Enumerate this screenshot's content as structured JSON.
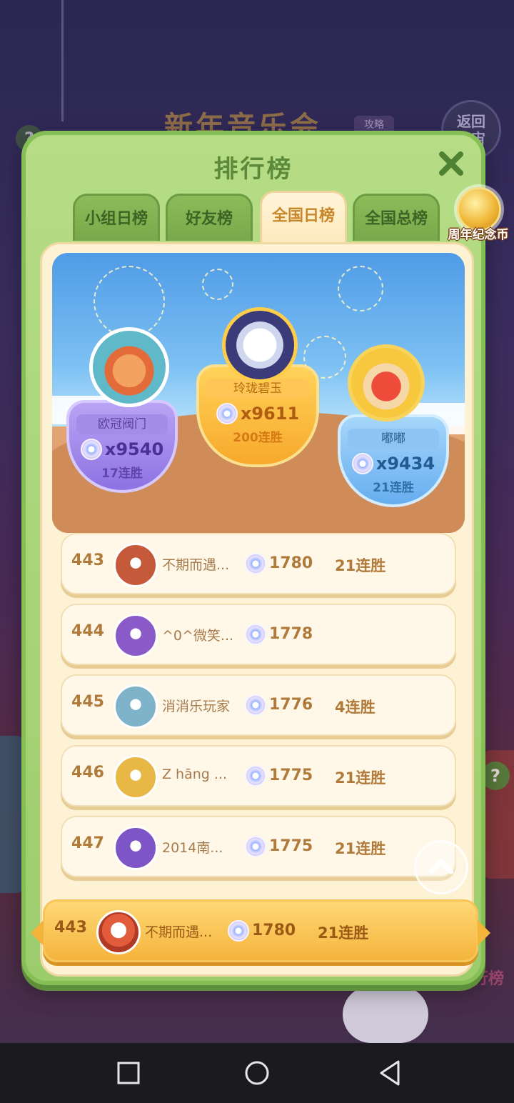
{
  "background": {
    "event_title": "新年音乐会",
    "strategy_label": "攻略",
    "return_label": "返回\n宇宙",
    "help_glyph": "?",
    "leaderboard_label": "排行榜"
  },
  "modal": {
    "title": "排行榜",
    "close_icon": "close-icon",
    "tabs": [
      {
        "label": "小组日榜",
        "active": false
      },
      {
        "label": "好友榜",
        "active": false
      },
      {
        "label": "全国日榜",
        "active": true
      },
      {
        "label": "全国总榜",
        "active": false
      }
    ],
    "coin_badge_label": "周年纪念币"
  },
  "podium": {
    "first": {
      "name": "玲珑碧玉",
      "score": "x9611",
      "streak": "200连胜"
    },
    "second": {
      "name": "欧冠阀门",
      "score": "x9540",
      "streak": "17连胜"
    },
    "third": {
      "name": "嘟嘟",
      "score": "x9434",
      "streak": "21连胜"
    }
  },
  "rows": [
    {
      "rank": "443",
      "name": "不期而遇...",
      "score": "1780",
      "streak": "21连胜",
      "avatar_color": "#c45a3a"
    },
    {
      "rank": "444",
      "name": "^0^微笑...",
      "score": "1778",
      "streak": "",
      "avatar_color": "#8a5bc8"
    },
    {
      "rank": "445",
      "name": "消消乐玩家",
      "score": "1776",
      "streak": "4连胜",
      "avatar_color": "#7fb3c9"
    },
    {
      "rank": "446",
      "name": "Z hāng ...",
      "score": "1775",
      "streak": "21连胜",
      "avatar_color": "#e7b846"
    },
    {
      "rank": "447",
      "name": "2014南...",
      "score": "1775",
      "streak": "21连胜",
      "avatar_color": "#7d55c6"
    }
  ],
  "my_row": {
    "rank": "443",
    "name": "不期而遇...",
    "score": "1780",
    "streak": "21连胜"
  },
  "colors": {
    "modal_green": "#9ccd6c",
    "panel_cream": "#fdf2d4",
    "gold": "#f7a92b",
    "purple": "#8d72e3",
    "blue": "#66aeef",
    "rank_text": "#b07a3a"
  },
  "nav": {
    "square": "recent-apps-icon",
    "circle": "home-icon",
    "triangle": "back-icon"
  }
}
